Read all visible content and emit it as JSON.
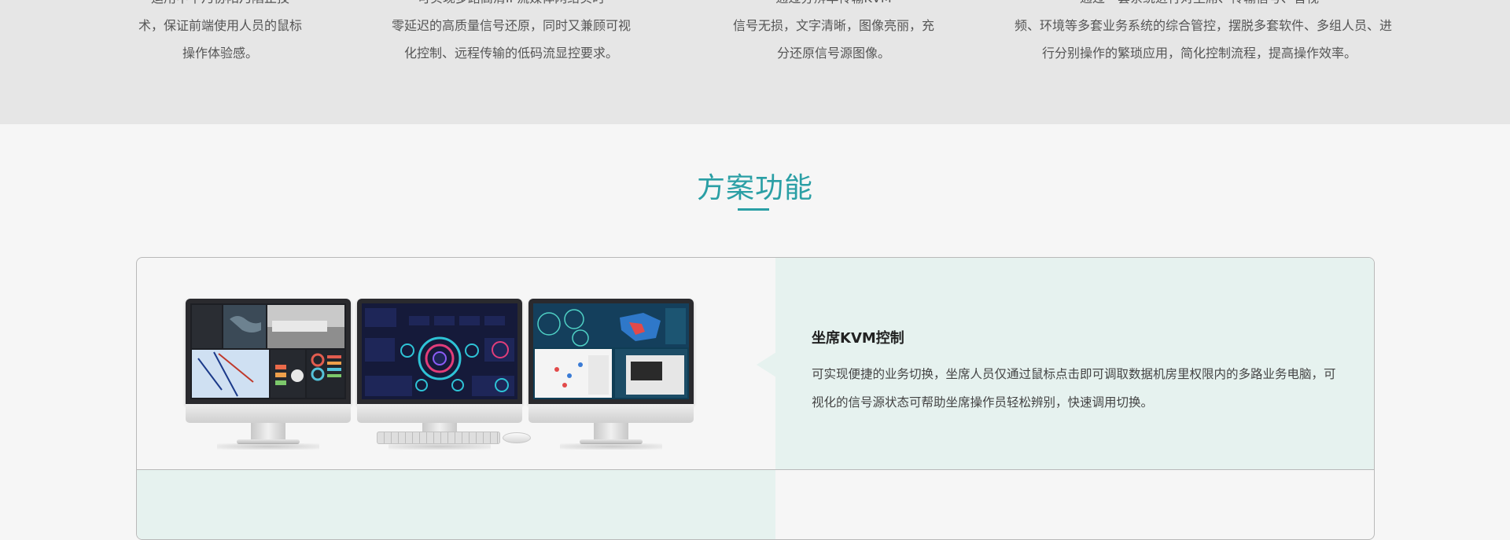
{
  "features": [
    {
      "lines": [
        "运用中平乃协阳乃陷止技",
        "术，保证前端使用人员的鼠标",
        "操作体验感。"
      ]
    },
    {
      "lines": [
        "可实现多路高清IP流媒体网络实时",
        "零延迟的高质量信号还原，同时又兼顾可视",
        "化控制、远程传输的低码流显控要求。"
      ]
    },
    {
      "lines": [
        "通过分辨率传输KVM",
        "信号无损，文字清晰，图像亮丽，充",
        "分还原信号源图像。"
      ]
    },
    {
      "lines": [
        "通过一套系统进行对坐席、传输信号、音视",
        "频、环境等多套业务系统的综合管控，摆脱多套软件、多组人员、进",
        "行分别操作的繁琐应用，简化控制流程，提高操作效率。"
      ]
    }
  ],
  "section": {
    "title": "方案功能"
  },
  "solutions": [
    {
      "title": "坐席KVM控制",
      "description": "可实现便捷的业务切换，坐席人员仅通过鼠标点击即可调取数据机房里权限内的多路业务电脑，可视化的信号源状态可帮助坐席操作员轻松辨别，快速调用切换。",
      "image_alt": "三台显示器坐席KVM控制示意图"
    }
  ],
  "colors": {
    "accent": "#2a9fa5",
    "panel_tint": "#e6f2ef",
    "top_band": "#e6e6e6",
    "page_bg": "#f6f6f6"
  }
}
